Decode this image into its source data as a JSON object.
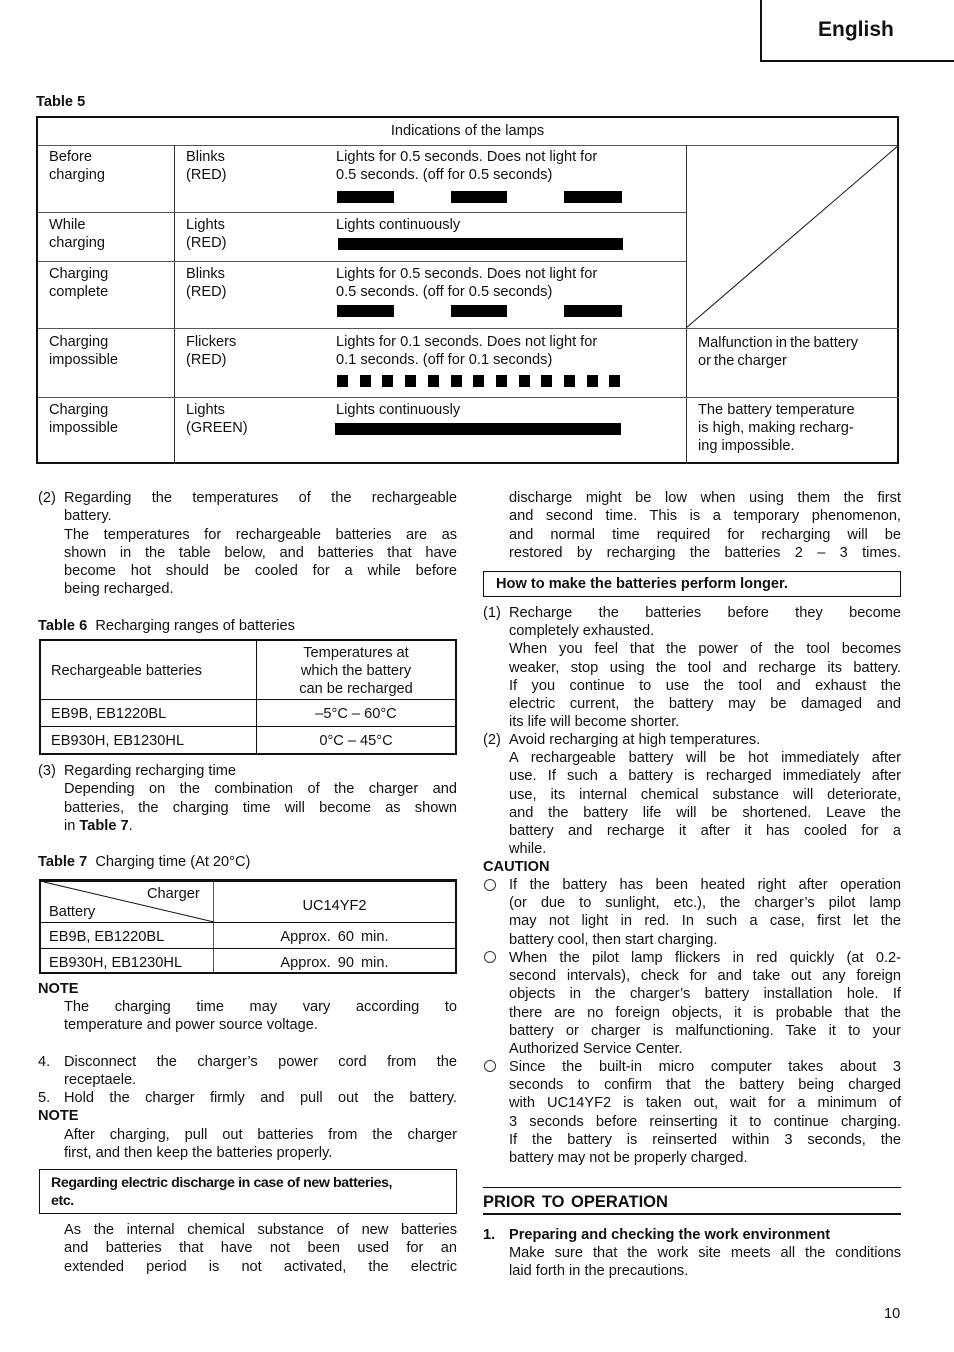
{
  "header": {
    "language": "English"
  },
  "table5": {
    "caption": "Table 5",
    "header": "Indications of the lamps",
    "rows": [
      {
        "state": [
          "Before",
          "charging"
        ],
        "lamp": [
          "Blinks",
          "(RED)"
        ],
        "desc": [
          "Lights for 0.5 seconds. Does not light for",
          "0.5 seconds. (off for 0.5 seconds)"
        ],
        "pattern": "blink",
        "note": []
      },
      {
        "state": [
          "While",
          "charging"
        ],
        "lamp": [
          "Lights",
          "(RED)"
        ],
        "desc": [
          "Lights continuously"
        ],
        "pattern": "continuous",
        "note": []
      },
      {
        "state": [
          "Charging",
          "complete"
        ],
        "lamp": [
          "Blinks",
          "(RED)"
        ],
        "desc": [
          "Lights for 0.5 seconds. Does not light for",
          "0.5 seconds. (off for 0.5 seconds)"
        ],
        "pattern": "blink",
        "note": []
      },
      {
        "state": [
          "Charging",
          "impossible"
        ],
        "lamp": [
          "Flickers",
          "(RED)"
        ],
        "desc": [
          "Lights for 0.1 seconds. Does not light for",
          "0.1 seconds. (off for 0.1 seconds)"
        ],
        "pattern": "flicker",
        "note": [
          "Malfunction in the battery",
          "or the charger"
        ]
      },
      {
        "state": [
          "Charging",
          "impossible"
        ],
        "lamp": [
          "Lights",
          "(GREEN)"
        ],
        "desc": [
          "Lights continuously"
        ],
        "pattern": "continuous",
        "note": [
          "The battery temperature",
          "is high, making recharg-",
          "ing impossible."
        ]
      }
    ]
  },
  "left": {
    "sec2": {
      "num": "(2)",
      "lines": [
        "Regarding the temperatures of the rechargeable",
        "battery.",
        "The temperatures for rechargeable batteries are as",
        "shown in the table below, and batteries that have",
        "become hot should be cooled for a while before",
        "being recharged."
      ]
    },
    "table6": {
      "caption_bold": "Table 6",
      "caption": "Recharging ranges of batteries",
      "col1": "Rechargeable batteries",
      "col2": [
        "Temperatures at",
        "which the battery",
        "can be recharged"
      ],
      "rows": [
        {
          "battery": "EB9B, EB1220BL",
          "range": "–5°C – 60°C"
        },
        {
          "battery": "EB930H, EB1230HL",
          "range": "0°C – 45°C"
        }
      ]
    },
    "sec3": {
      "num": "(3)",
      "lines": [
        "Regarding recharging time",
        "Depending on the combination of the charger and",
        "batteries, the charging time will become as shown"
      ],
      "last_prefix": "in ",
      "last_bold": "Table 7",
      "last_suffix": "."
    },
    "table7": {
      "caption_bold": "Table 7",
      "caption": "Charging time (At 20°C)",
      "corner_top": "Charger",
      "corner_bottom": "Battery",
      "charger": "UC14YF2",
      "rows": [
        {
          "battery": "EB9B, EB1220BL",
          "time": "Approx. 60 min."
        },
        {
          "battery": "EB930H, EB1230HL",
          "time": "Approx. 90 min."
        }
      ]
    },
    "note1": {
      "title": "NOTE",
      "lines": [
        "The charging time may vary according to",
        "temperature and power source voltage."
      ]
    },
    "step4": {
      "num": "4.",
      "lines": [
        "Disconnect the charger’s power cord from the",
        "receptaele."
      ]
    },
    "step5": {
      "num": "5.",
      "text": "Hold the charger firmly and pull out the battery."
    },
    "note2": {
      "title": "NOTE",
      "lines": [
        "After charging, pull out batteries from the charger",
        "first, and then keep the batteries properly."
      ]
    },
    "box_heading": [
      "Regarding electric discharge in case of new batteries,",
      "etc."
    ],
    "discharge": [
      "As the internal chemical substance of new batteries",
      "and batteries that have not been used for an",
      "extended period is not activated, the electric"
    ]
  },
  "right": {
    "discharge_cont": [
      "discharge might be low when using them the first",
      "and second time. This is a temporary phenomenon,",
      "and normal time required for recharging will be",
      "restored by recharging the batteries 2 – 3 times."
    ],
    "box_heading": "How to make the batteries perform longer.",
    "item1": {
      "num": "(1)",
      "lines": [
        "Recharge the batteries before they become",
        "completely exhausted.",
        "When you feel that the power of the tool becomes",
        "weaker, stop using the tool and recharge its battery.",
        "If you continue to use the tool and exhaust the",
        "electric current, the battery may be damaged and",
        "its life will become shorter."
      ]
    },
    "item2": {
      "num": "(2)",
      "lines": [
        "Avoid recharging at high temperatures.",
        "A rechargeable battery will be hot immediately after",
        "use. If such a battery is recharged immediately after",
        "use, its internal chemical substance will deteriorate,",
        "and the battery life will be shortened. Leave the",
        "battery and recharge it after it has cooled for a",
        "while."
      ]
    },
    "caution": {
      "title": "CAUTION",
      "bullets": [
        [
          "If the battery has been heated right after operation",
          "(or due to sunlight, etc.), the charger’s pilot lamp",
          "may not light in red. In such a case, first let the",
          "battery cool, then start charging."
        ],
        [
          "When the pilot lamp flickers in red quickly (at 0.2-",
          "second intervals), check for and take out any foreign",
          "objects in the charger’s battery installation hole. If",
          "there are no foreign objects, it is probable that the",
          "battery or charger is malfunctioning. Take it to your",
          "Authorized Service Center."
        ],
        [
          "Since the built-in micro computer takes about 3",
          "seconds to confirm that the battery being charged",
          "with UC14YF2 is taken out, wait for a minimum of",
          "3 seconds before reinserting it to continue charging.",
          "If the battery is reinserted within 3 seconds, the",
          "battery may not be properly charged."
        ]
      ]
    },
    "section_title": "PRIOR TO OPERATION",
    "prep": {
      "num": "1.",
      "title": "Preparing and checking the work environment",
      "lines": [
        "Make sure that the work site meets all the conditions",
        "laid forth in the precautions."
      ]
    }
  },
  "footer": {
    "page_number": "10"
  }
}
